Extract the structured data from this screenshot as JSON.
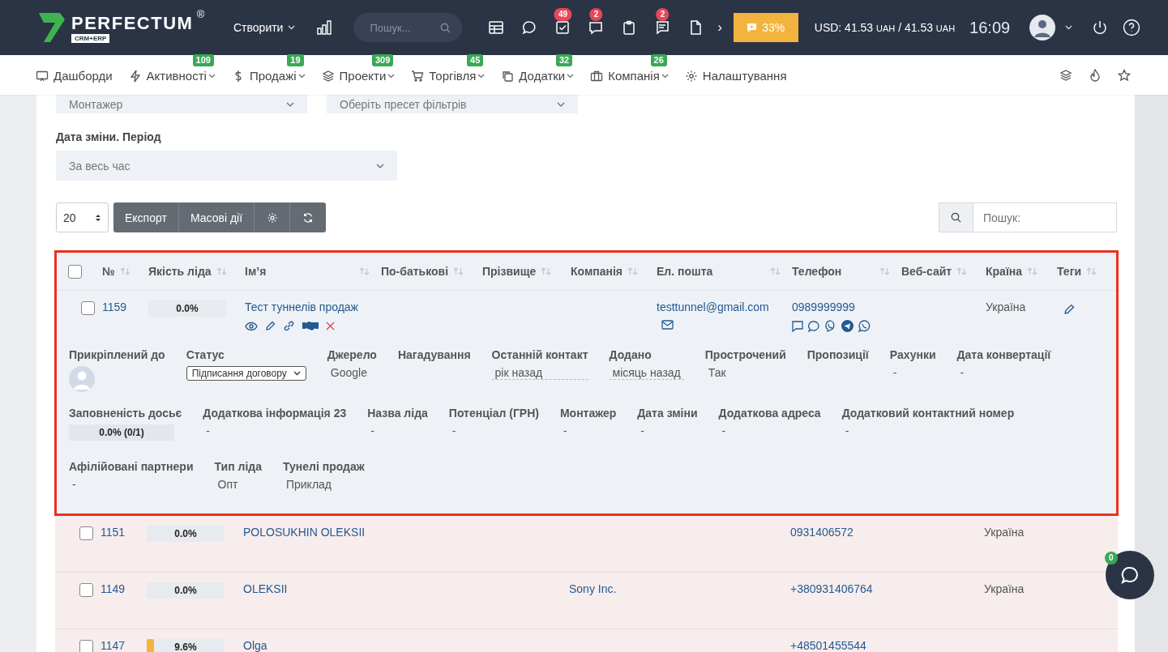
{
  "topbar": {
    "logo": "PERFECTUM",
    "logo_mark": "®",
    "logo_sub": "CRM+ERP",
    "create": "Створити",
    "search": {
      "placeholder": "Пошук..."
    },
    "icons": [
      {
        "kind": "table"
      },
      {
        "kind": "chat"
      },
      {
        "kind": "task",
        "badge": "49"
      },
      {
        "kind": "messages",
        "badge": "2"
      },
      {
        "kind": "clipboard"
      },
      {
        "kind": "notes",
        "badge": "2"
      },
      {
        "kind": "file"
      }
    ],
    "more": "›",
    "progress": "33%",
    "currency": "USD: 41.53",
    "currency_unit": "UAH",
    "currency_sep": "/",
    "currency2": "41.53",
    "currency_unit2": "UAH",
    "time": "16:09"
  },
  "nav": [
    {
      "label": "Дашборди",
      "caret": false
    },
    {
      "label": "Активності",
      "badge": "109",
      "caret": true
    },
    {
      "label": "Продажі",
      "badge": "19",
      "caret": true
    },
    {
      "label": "Проекти",
      "badge": "309",
      "caret": true
    },
    {
      "label": "Торгівля",
      "badge": "45",
      "caret": true
    },
    {
      "label": "Додатки",
      "badge": "32",
      "caret": true
    },
    {
      "label": "Компанія",
      "badge": "26",
      "caret": true
    },
    {
      "label": "Налаштування",
      "caret": false
    }
  ],
  "filters": {
    "top": [
      "Монтажер",
      "Оберіть пресет фільтрів"
    ],
    "period_label": "Дата зміни. Період",
    "period": "За весь час"
  },
  "toolbar": {
    "page_size": "20",
    "buttons": [
      "Експорт",
      "Масові дії"
    ],
    "search": {
      "placeholder": "Пошук:"
    }
  },
  "table": {
    "select_all": {
      "checked": false
    },
    "columns": [
      "№",
      "Якість ліда",
      "Імʼя",
      "По-батькові",
      "Прізвище",
      "Компанія",
      "Ел. пошта",
      "Телефон",
      "Веб-сайт",
      "Країна",
      "Теги"
    ],
    "expanded": {
      "checked": false,
      "id": "1159",
      "quality": "0.0%",
      "level": 0.0,
      "name": "Тест туннелів продаж",
      "email": "testtunnel@gmail.com",
      "phone": "0989999999",
      "country": "Україна",
      "details": [
        [
          {
            "label": "Прикріплений до",
            "kind": "avatar"
          },
          {
            "label": "Статус",
            "kind": "select",
            "value": "Підписання договору"
          },
          {
            "label": "Джерело",
            "kind": "text",
            "value": "Google"
          },
          {
            "label": "Нагадування",
            "kind": "text"
          },
          {
            "label": "Останній контакт",
            "kind": "dotted",
            "value": "рік назад"
          },
          {
            "label": "Додано",
            "kind": "dotted",
            "value": "місяць назад"
          },
          {
            "label": "Прострочений",
            "kind": "text",
            "value": "Так"
          },
          {
            "label": "Пропозиції",
            "kind": "text"
          },
          {
            "label": "Рахунки",
            "kind": "text",
            "value": "-"
          },
          {
            "label": "Дата конвертації",
            "kind": "text",
            "value": "-"
          }
        ],
        [
          {
            "label": "Заповненість досьє",
            "kind": "progress",
            "value": "0.0% (0/1)",
            "level": 0.0
          },
          {
            "label": "Додаткова інформація 23",
            "kind": "text",
            "value": "-"
          },
          {
            "label": "Назва ліда",
            "kind": "text",
            "value": "-"
          },
          {
            "label": "Потенціал (ГРН)",
            "kind": "text",
            "value": "-"
          },
          {
            "label": "Монтажер",
            "kind": "text",
            "value": "-"
          },
          {
            "label": "Дата зміни",
            "kind": "text",
            "value": "-"
          },
          {
            "label": "Додаткова адреса",
            "kind": "text",
            "value": "-"
          },
          {
            "label": "Додатковий контактний номер",
            "kind": "text",
            "value": "-"
          }
        ],
        [
          {
            "label": "Афілійовані партнери",
            "kind": "text",
            "value": "-"
          },
          {
            "label": "Тип ліда",
            "kind": "text",
            "value": "Опт"
          },
          {
            "label": "Тунелі продаж",
            "kind": "text",
            "value": "Приклад"
          }
        ]
      ]
    },
    "rows": [
      {
        "checked": false,
        "id": "1151",
        "quality": "0.0%",
        "level": 0.0,
        "name": "POLOSUKHIN OLEKSII",
        "phone": "0931406572",
        "country": "Україна"
      },
      {
        "checked": false,
        "id": "1149",
        "quality": "0.0%",
        "level": 0.0,
        "name": "OLEKSII",
        "company": "Sony Inc.",
        "phone": "+380931406764",
        "country": "Україна"
      },
      {
        "checked": false,
        "id": "1147",
        "quality": "9.6%",
        "level": 0.096,
        "name": "Olga",
        "phone": "+48501455544"
      }
    ]
  },
  "chat": {
    "badge": "0"
  }
}
